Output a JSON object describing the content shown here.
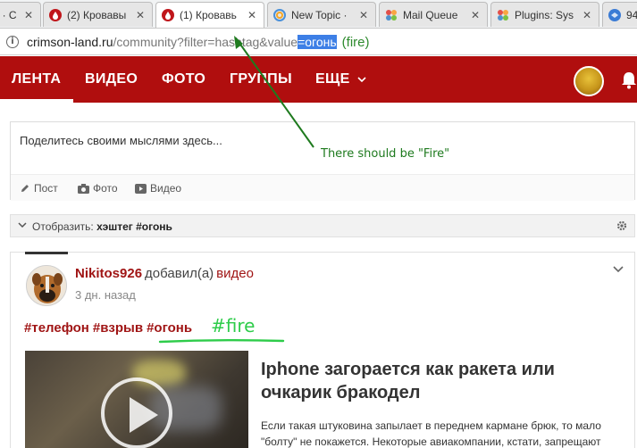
{
  "browser": {
    "tabs": [
      {
        "label": "ь · С",
        "favicon": "chromium-icon",
        "color": "#9e9e9e"
      },
      {
        "label": "(2) Кровавы",
        "favicon": "blood-drop-icon",
        "color": "#c0161b"
      },
      {
        "label": "(1) Кровавь",
        "favicon": "blood-drop-icon",
        "color": "#c0161b",
        "active": true
      },
      {
        "label": "New Topic ·",
        "favicon": "swirl-icon",
        "color": "#4a90d9"
      },
      {
        "label": "Mail Queue",
        "favicon": "joomla-icon",
        "color": "#e2504a"
      },
      {
        "label": "Plugins: Sys",
        "favicon": "joomla-icon",
        "color": "#e2504a"
      },
      {
        "label": "94.",
        "favicon": "globe-icon",
        "color": "#3a7bd5"
      }
    ],
    "address": {
      "host": "crimson-land.ru",
      "path": "/community?filter=hashtag&value",
      "selected": "=огонь",
      "note": "(fire)"
    }
  },
  "nav": {
    "items": [
      "ЛЕНТА",
      "ВИДЕО",
      "ФОТО",
      "ГРУППЫ",
      "ЕЩЕ"
    ]
  },
  "composer": {
    "placeholder": "Поделитесь своими мыслями здесь...",
    "actions": [
      "Пост",
      "Фото",
      "Видео"
    ]
  },
  "filter": {
    "label": "Отобразить:",
    "value": "хэштег #огонь"
  },
  "post": {
    "author": "Nikitos926",
    "action": "добавил(а)",
    "object": "видео",
    "time": "3 дн. назад",
    "tags": [
      "#телефон",
      "#взрыв",
      "#огонь"
    ],
    "fire_note": "#fire",
    "video": {
      "title": "Iphone загорается как ракета или очкарик бракодел",
      "description": "Если такая штуковина запылает в переднем кармане брюк, то мало \"болту\" не покажется. Некоторые авиакомпании, кстати, запрещают"
    }
  },
  "annotation": {
    "text": "There should be \"Fire\"",
    "color": "#1e7a1e"
  },
  "colors": {
    "brand": "#b00e0e",
    "link": "#a01515",
    "selection": "#3d7fe6",
    "annotation_green": "#2e8b2e",
    "fire_green": "#2ecc4a"
  }
}
